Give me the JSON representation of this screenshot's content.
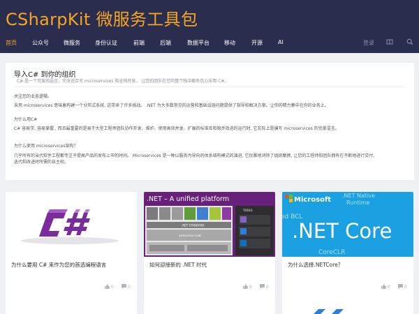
{
  "header": {
    "site_title": "CSharpKit 微服务工具包",
    "login": "登录",
    "nav": [
      {
        "label": "首页",
        "active": true
      },
      {
        "label": "公众号"
      },
      {
        "label": "微服务"
      },
      {
        "label": "身份认证"
      },
      {
        "label": "前端"
      },
      {
        "label": "后端"
      },
      {
        "label": "数据平台"
      },
      {
        "label": "移动"
      },
      {
        "label": "开源"
      },
      {
        "label": "AI"
      }
    ],
    "icons": [
      "grid-icon",
      "search-icon"
    ]
  },
  "intro": {
    "title": "导入C# 到你的组织",
    "subtitle": "C# 是一个可爱的语言，完全适合写 microservices 和全栈开发。 让您的团队在您的整个栈中都有信心采用 C#。",
    "sections": [
      {
        "heading": "关注您的业务逻辑。",
        "body": "采用 microservices 意味着构建一个分布式系统, 这带来了许多挑战。 .NET 为大多数常见的运营和基础设施问题提供了指导和解决方案。让你的精力集中在你的业务上。"
      },
      {
        "heading": "为什么用C#",
        "body": "C# 容易学, 容易掌握 , 而且最重要的是易于大型工程师团队协作开发、维护、使用高效并发、扩展的标准库和稳步改进的运行时, 它实际上是编写 microservices 的完美语言。"
      },
      {
        "heading": "为什么使用 microservices架构？",
        "body_lines": [
          "几乎所有的当代软件工程都专注于提高产品的发布上市的时间。 Microservices 是一种以服务为导向的体系结构模式的演进, 它优雅地消除了组织摩擦, 让您的工程师和团队拥有在不断地进行交付、",
          "迭代和改进时所需的自主权。"
        ]
      }
    ]
  },
  "posts": [
    {
      "title": "为什么要用 C# 来作为您的首选编程语言",
      "likes": "0",
      "comments": "0",
      "thumb": "csharp-logo"
    },
    {
      "title": "如何迎接新的 .NET 时代",
      "likes": "0",
      "comments": "0",
      "thumb": "net-unified-platform",
      "thumb_text": {
        "heading": ".NET – A unified platform",
        "tools": "TOOLS",
        "standard": ".NET STANDARD",
        "infra": "INFRASTRUCTURE"
      }
    },
    {
      "title": "为什么选择.NETCore？",
      "likes": "0",
      "comments": "0",
      "thumb": "net-core",
      "thumb_text": {
        "brand": "Microsoft",
        "big": ".NET Core",
        "native": ".NET Native",
        "runtime": "Runtime",
        "bcl": "ed BCL",
        "clr": "CoreCLR"
      }
    }
  ],
  "colors": {
    "header_bg": "#2a2d4e",
    "accent": "#f5a623",
    "page_bg": "#eff0f3",
    "net_purple": "#68217a",
    "core_blue": "#1ba1e2"
  }
}
